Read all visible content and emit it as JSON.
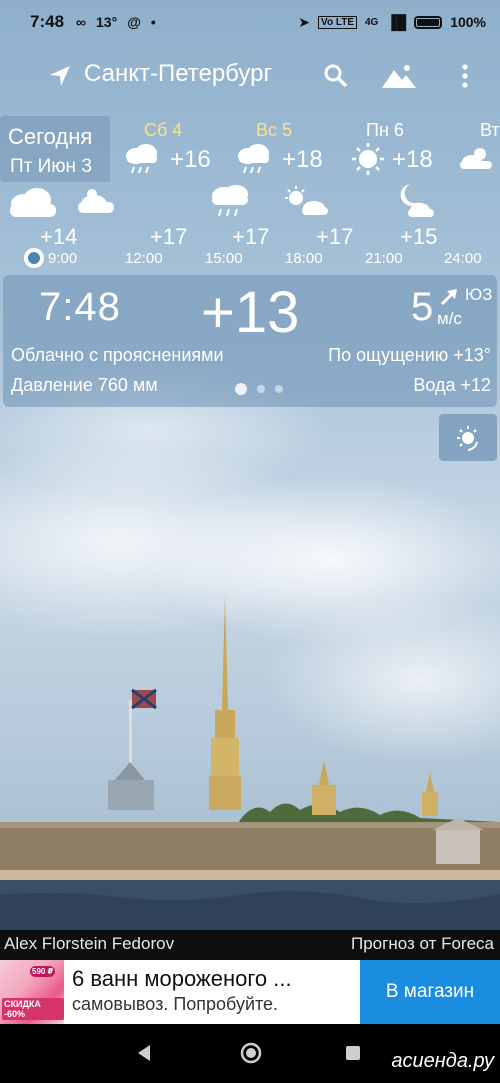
{
  "status": {
    "time": "7:48",
    "temp": "13°",
    "network": "4G",
    "battery": "100%"
  },
  "header": {
    "city": "Санкт-Петербург",
    "icons": [
      "location-arrow-icon",
      "search-icon",
      "photo-mountain-icon",
      "more-vert-icon"
    ]
  },
  "today": {
    "label": "Сегодня",
    "date": "Пт Июн 3"
  },
  "days": [
    {
      "name": "Сб 4",
      "temp": "+16",
      "icon": "rain-cloud-icon",
      "weekend": true
    },
    {
      "name": "Вс 5",
      "temp": "+18",
      "icon": "rain-cloud-icon",
      "weekend": true
    },
    {
      "name": "Пн 6",
      "temp": "+18",
      "icon": "sun-icon",
      "weekend": false
    },
    {
      "name": "Вт",
      "temp": "",
      "icon": "cloud-sun-icon",
      "weekend": false
    }
  ],
  "hourly": [
    {
      "time": "9:00",
      "temp": "+14",
      "icon": "cloud-icon"
    },
    {
      "time": "12:00",
      "temp": "+17",
      "icon": "partly-cloudy-icon"
    },
    {
      "time": "15:00",
      "temp": "+17",
      "icon": "rain-cloud-icon"
    },
    {
      "time": "18:00",
      "temp": "+17",
      "icon": "partly-cloudy-icon"
    },
    {
      "time": "21:00",
      "temp": "+15",
      "icon": "moon-cloud-icon"
    },
    {
      "time": "24:00",
      "temp": "",
      "icon": ""
    }
  ],
  "current": {
    "time": "7:48",
    "temp": "+13",
    "wind_speed": "5",
    "wind_dir": "ЮЗ",
    "wind_unit": "м/с",
    "description": "Облачно с прояснениями",
    "feels_like": "По ощущению +13°",
    "pressure": "Давление 760 мм",
    "water": "Вода +12"
  },
  "credits": {
    "photo_author": "Alex Florstein Fedorov",
    "provider": "Прогноз от Foreca"
  },
  "ad": {
    "title": "6 ванн мороженого ...",
    "text": "самовывоз. Попробуйте.",
    "badge_price": "590 ₽",
    "badge_sale": "СКИДКА -60%",
    "cta": "В магазин"
  },
  "watermark": "асиенда.ру",
  "colors": {
    "weekend": "#ffe08a",
    "cta": "#1a8de0",
    "panel": "#6e91b4"
  }
}
